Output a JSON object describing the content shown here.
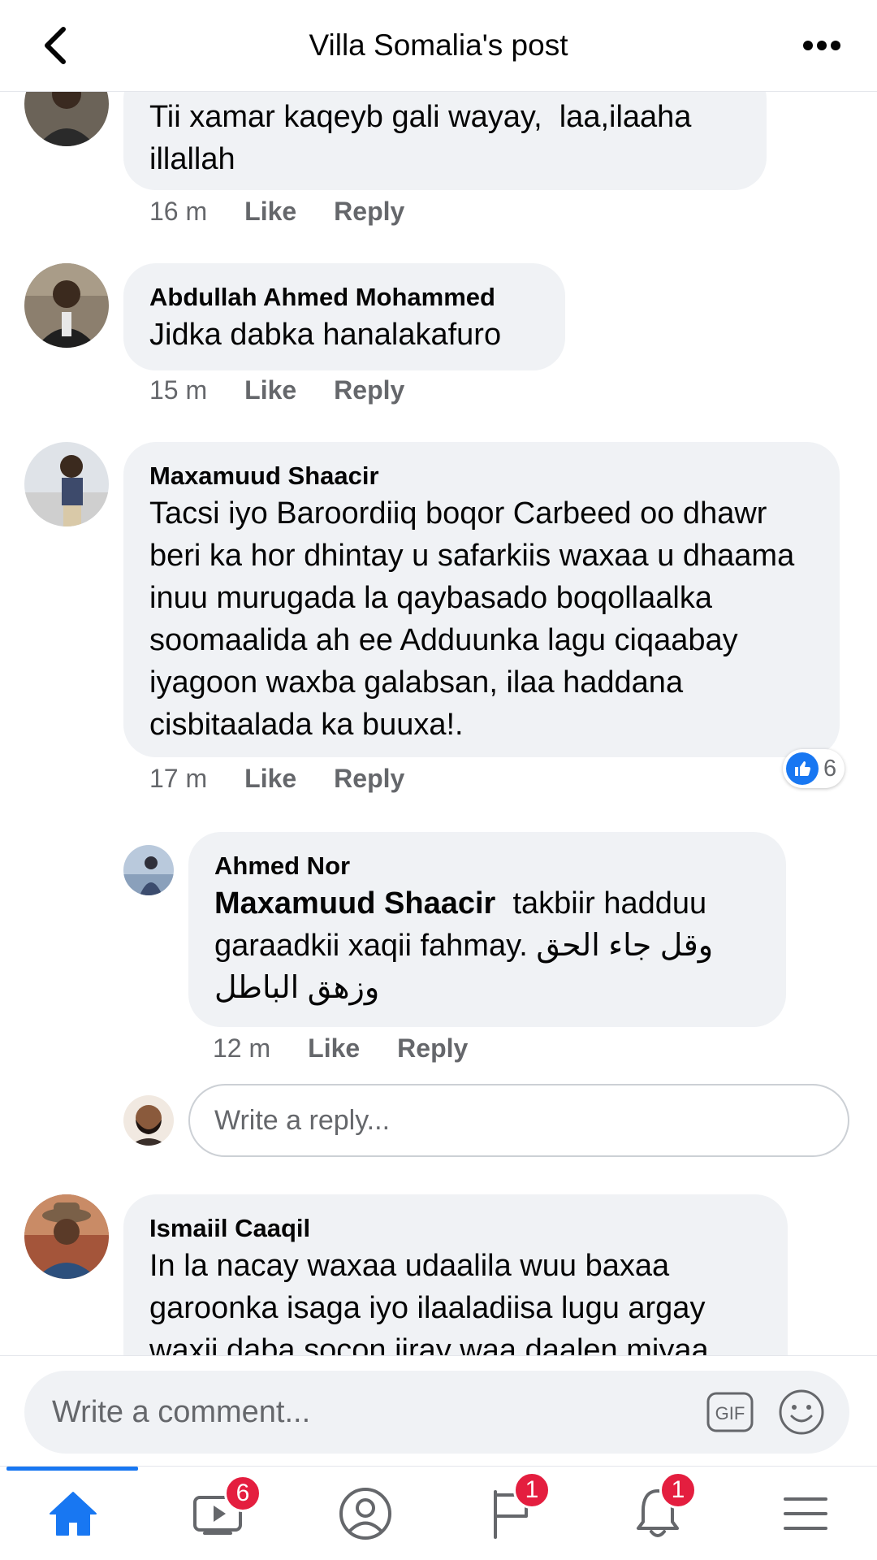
{
  "header": {
    "title": "Villa Somalia's post",
    "back_icon": "chevron-left-icon",
    "more_icon": "more-dots-icon"
  },
  "comments": [
    {
      "name": "",
      "text": "Tii xamar kaqeyb gali wayay,  laa,ilaaha illallah",
      "time": "16 m",
      "like": "Like",
      "reply": "Reply"
    },
    {
      "name": "Abdullah Ahmed Mohammed",
      "text": "Jidka dabka hanalakafuro",
      "time": "15 m",
      "like": "Like",
      "reply": "Reply"
    },
    {
      "name": "Maxamuud Shaacir",
      "text": "Tacsi iyo Baroordiiq boqor Carbeed oo dhawr beri ka hor dhintay u safarkiis waxaa u dhaama inuu murugada la qaybasado boqollaalka soomaalida ah ee Adduunka lagu ciqaabay iyagoon waxba galabsan, ilaa haddana cisbitaalada ka buuxa!.",
      "time": "17 m",
      "like": "Like",
      "reply": "Reply",
      "reaction_count": "6"
    },
    {
      "name": "Ismaiil Caaqil",
      "text": "In la nacay waxaa udaalila wuu baxaa garoonka isaga iyo ilaaladiisa lugu argay waxii daba socon jiray waa daalen miyaa"
    }
  ],
  "reply_comment": {
    "name": "Ahmed Nor",
    "mention": "Maxamuud Shaacir",
    "text": "takbiir hadduu garaadkii xaqii fahmay. وقل جاء الحق وزهق الباطل",
    "time": "12 m",
    "like": "Like",
    "reply": "Reply"
  },
  "reply_input": {
    "placeholder": "Write a reply..."
  },
  "composer": {
    "placeholder": "Write a comment...",
    "gif_label": "GIF",
    "emoji_icon": "emoji-icon"
  },
  "nav": {
    "items": [
      {
        "icon": "home-icon",
        "badge": ""
      },
      {
        "icon": "video-icon",
        "badge": "6"
      },
      {
        "icon": "profile-icon",
        "badge": ""
      },
      {
        "icon": "flag-icon",
        "badge": "1"
      },
      {
        "icon": "bell-icon",
        "badge": "1"
      },
      {
        "icon": "menu-icon",
        "badge": ""
      }
    ]
  },
  "colors": {
    "accent": "#1877f2",
    "bubble": "#f0f2f5",
    "secondary_text": "#65676b",
    "badge": "#e41e3f"
  }
}
